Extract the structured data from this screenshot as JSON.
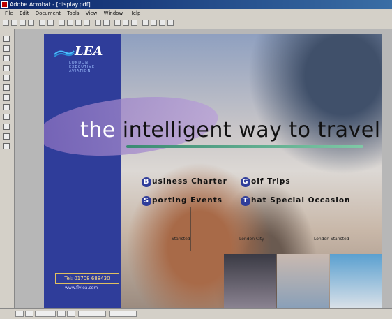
{
  "window": {
    "title": "Adobe Acrobat - [display.pdf]"
  },
  "menu": {
    "items": [
      "File",
      "Edit",
      "Document",
      "Tools",
      "View",
      "Window",
      "Help"
    ]
  },
  "brochure": {
    "logo_text": "LEA",
    "logo_subtitle": "LONDON EXECUTIVE AVIATION",
    "tagline_first": "the",
    "tagline_rest": "intelligent way to travel",
    "services": [
      {
        "initial": "B",
        "rest": "usiness Charter"
      },
      {
        "initial": "G",
        "rest": "olf Trips"
      },
      {
        "initial": "S",
        "rest": "porting Events"
      },
      {
        "initial": "T",
        "rest": "hat Special Occasion"
      }
    ],
    "captions": [
      "Stansted",
      "London City",
      "London Stansted"
    ],
    "phone": "Tel: 01708 688430",
    "website": "www.flylea.com"
  },
  "colors": {
    "brand_blue": "#2f3d9a",
    "accent_purple": "#8a6fbf",
    "accent_green": "#3a8a72"
  }
}
